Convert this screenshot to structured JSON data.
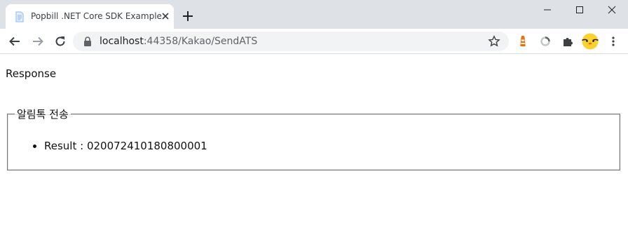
{
  "browser": {
    "tab": {
      "title": "Popbill .NET Core SDK Example",
      "favicon": "document-icon",
      "close_icon": "close-icon"
    },
    "new_tab_icon": "plus-icon",
    "window_controls": [
      "minimize-icon",
      "maximize-icon",
      "close-icon"
    ],
    "toolbar": {
      "back_icon": "arrow-left-icon",
      "forward_icon": "arrow-right-icon",
      "reload_icon": "reload-icon",
      "url_host": "localhost",
      "url_rest": ":44358/Kakao/SendATS",
      "star_icon": "star-icon",
      "extensions": [
        "lighthouse-icon",
        "loading-icon",
        "puzzle-icon",
        "profile-avatar-icon",
        "more-vert-icon"
      ]
    }
  },
  "page": {
    "heading": "Response",
    "fieldset": {
      "legend": "알림톡 전송",
      "items": [
        "Result : 020072410180800001"
      ]
    }
  },
  "colors": {
    "tabstrip": "#dee1e6",
    "omnibox": "#f1f3f4",
    "extension_orange": "#e8710a",
    "avatar_yellow": "#fbd130"
  }
}
